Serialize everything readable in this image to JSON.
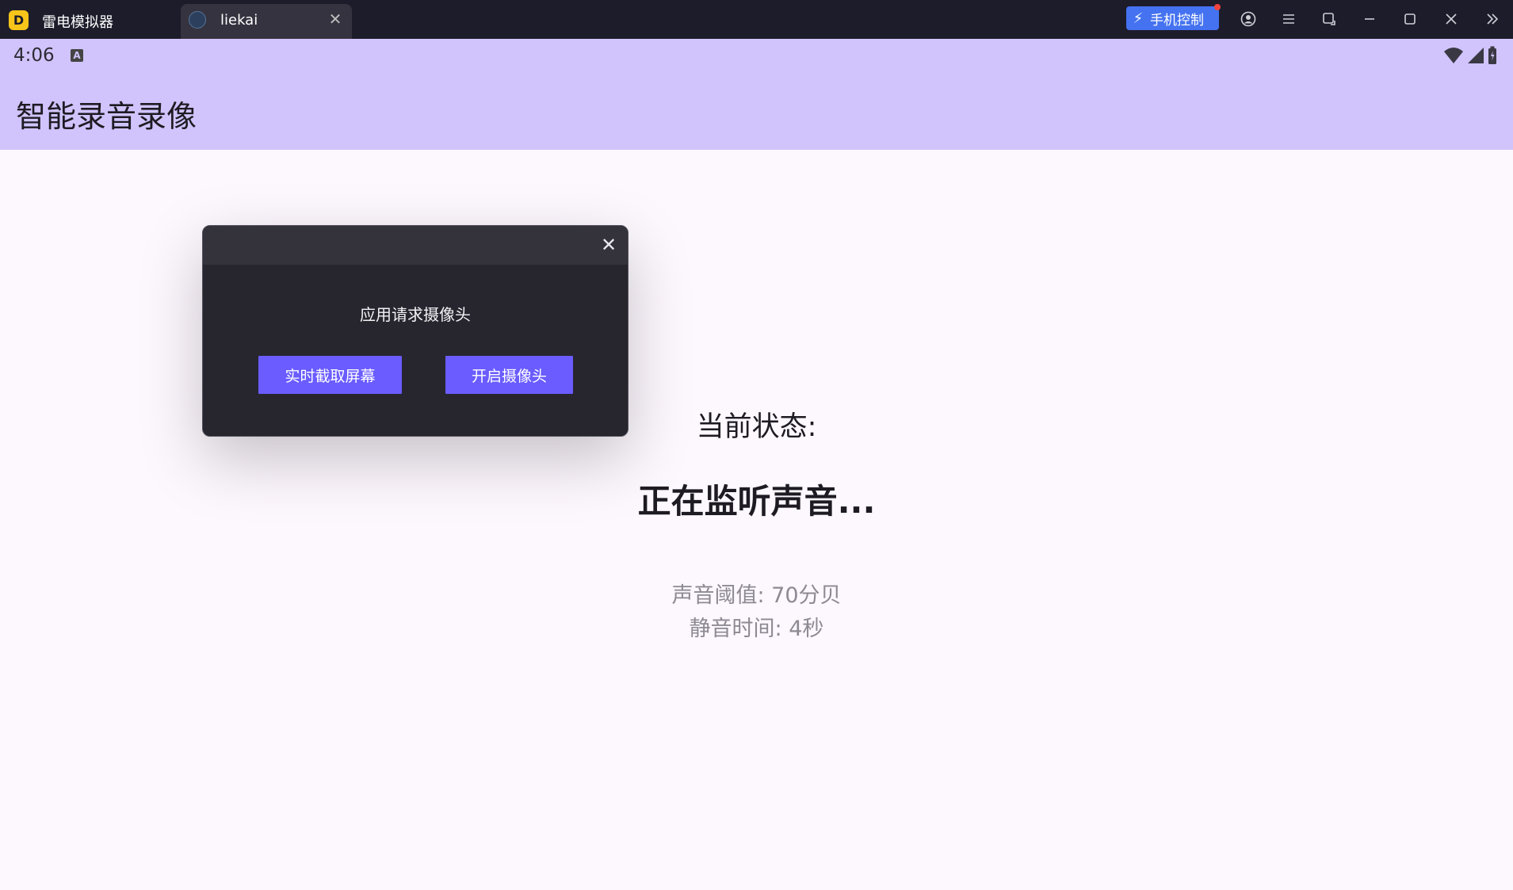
{
  "window": {
    "app_name": "雷电模拟器",
    "tab_label": "liekai",
    "phone_control_label": "手机控制"
  },
  "status_bar": {
    "time": "4:06",
    "indicator": "A"
  },
  "app": {
    "title": "智能录音录像",
    "status_label": "当前状态:",
    "status_value": "正在监听声音...",
    "threshold_text": "声音阈值: 70分贝",
    "silence_text": "静音时间: 4秒"
  },
  "dialog": {
    "message": "应用请求摄像头",
    "left_button": "实时截取屏幕",
    "right_button": "开启摄像头"
  },
  "colors": {
    "titlebar": "#1d1c2b",
    "appbar": "#d1c4fd",
    "background": "#fdf7fe",
    "accent_button": "#6a5cff",
    "phone_control": "#4472f0"
  },
  "icons": {
    "titlebar": [
      "account-icon",
      "menu-icon",
      "rotate-icon",
      "minimize-icon",
      "maximize-icon",
      "close-icon",
      "double-chevron-icon"
    ],
    "status": [
      "wifi-icon",
      "signal-icon",
      "battery-icon"
    ]
  }
}
